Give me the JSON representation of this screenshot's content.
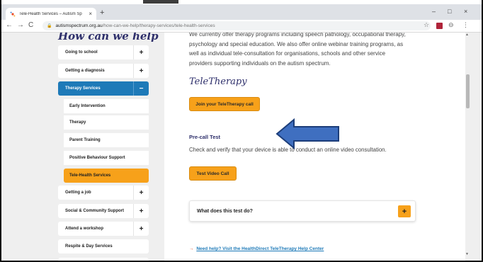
{
  "browser": {
    "tab_title": "Tele-Health Services – Autism Sp",
    "tab_close": "×",
    "new_tab": "+",
    "win_min": "–",
    "win_max": "□",
    "win_close": "×",
    "back": "←",
    "forward": "→",
    "reload": "C",
    "url_domain": "autismspectrum.org.au",
    "url_path": "/how-can-we-help/therapy-services/tele-health-services",
    "star": "☆",
    "profile": "⊖",
    "menu": "⋮"
  },
  "sidebar": {
    "heading": "How can we help",
    "items": [
      {
        "label": "Going to school",
        "toggle": "+"
      },
      {
        "label": "Getting a diagnosis",
        "toggle": "+"
      },
      {
        "label": "Therapy Services",
        "toggle": "−"
      },
      {
        "label": "Getting a job",
        "toggle": "+"
      },
      {
        "label": "Social & Community Support",
        "toggle": "+"
      },
      {
        "label": "Attend a workshop",
        "toggle": "+"
      },
      {
        "label": "Respite & Day Services"
      }
    ],
    "sub_items": [
      "Early Intervention",
      "Therapy",
      "Parent Training",
      "Positive Behaviour Support",
      "Tele-Health Services"
    ]
  },
  "main": {
    "intro_lines": [
      "We currently offer therapy programs including speech pathology, occupational therapy,",
      "psychology and special education. We also offer online webinar training programs, as",
      "well as individual tele-consultation for organisations, schools and other service",
      "providers supporting individuals on the autism spectrum."
    ],
    "teletherapy_title": "TeleTherapy",
    "join_button": "Join your TeleTherapy call",
    "precall_title": "Pre-call Test",
    "precall_text": "Check and verify that your device is able to conduct an online video consultation.",
    "test_button": "Test Video Call",
    "accordion_label": "What does this test do?",
    "accordion_toggle": "+",
    "help_arrow": "→",
    "help_link": "Need help? Visit the HealthDirect TeleTherapy Help Center"
  },
  "colors": {
    "orange": "#f7a11a",
    "blue": "#1e7ab8",
    "navy": "#2e2f6b",
    "annotation_arrow": "#3f6fc0"
  }
}
